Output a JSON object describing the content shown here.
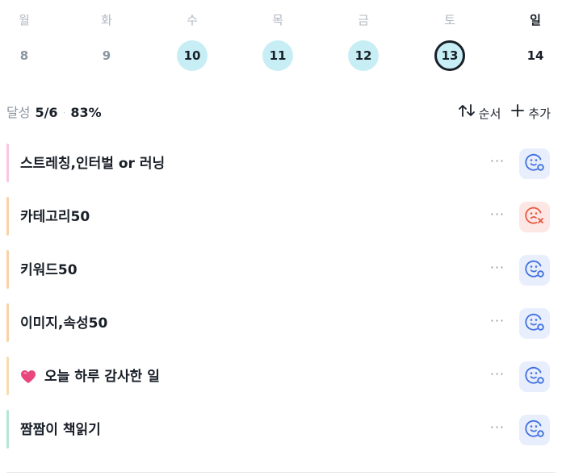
{
  "week": [
    {
      "name": "월",
      "date": "8",
      "state": "plain"
    },
    {
      "name": "화",
      "date": "9",
      "state": "plain"
    },
    {
      "name": "수",
      "date": "10",
      "state": "done"
    },
    {
      "name": "목",
      "date": "11",
      "state": "done"
    },
    {
      "name": "금",
      "date": "12",
      "state": "done"
    },
    {
      "name": "토",
      "date": "13",
      "state": "today"
    },
    {
      "name": "일",
      "date": "14",
      "state": "sunday"
    }
  ],
  "summary": {
    "label": "달성",
    "count": "5/6",
    "separator": "·",
    "percent": "83%"
  },
  "actions": {
    "sort_label": "순서",
    "add_label": "추가"
  },
  "habits": [
    {
      "title": "스트레칭,인터벌 or 러닝",
      "color": "#f8c8df",
      "status": "ok",
      "has_emoji": false
    },
    {
      "title": "카테고리50",
      "color": "#f7d3a6",
      "status": "fail",
      "has_emoji": false
    },
    {
      "title": "키워드50",
      "color": "#f7d3a6",
      "status": "ok",
      "has_emoji": false
    },
    {
      "title": "이미지,속성50",
      "color": "#f7d3a6",
      "status": "ok",
      "has_emoji": false
    },
    {
      "title": "오늘 하루 감사한 일",
      "color": "#f7dcb0",
      "status": "ok",
      "has_emoji": true,
      "emoji": "heart-icon"
    },
    {
      "title": "짬짬이 책읽기",
      "color": "#b6e6d8",
      "status": "ok",
      "has_emoji": false
    }
  ],
  "more_label": "···",
  "colors": {
    "done_bg": "#c7eef4",
    "ok_icon": "#3f6fe0",
    "fail_icon": "#e5573f",
    "heart": "#e8467c"
  }
}
